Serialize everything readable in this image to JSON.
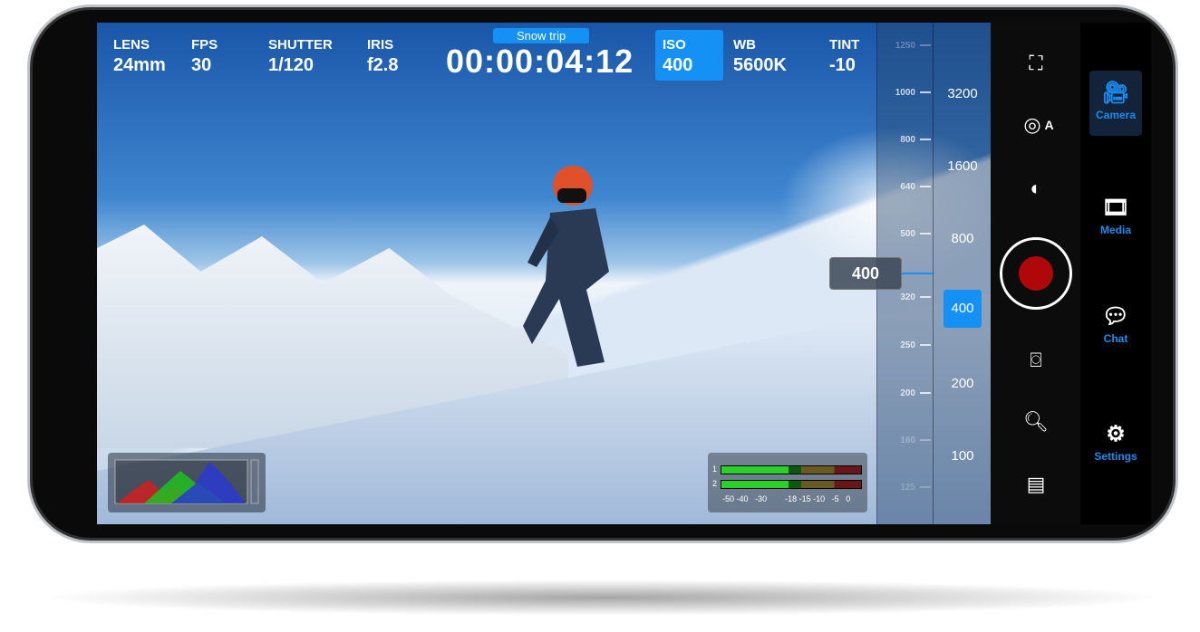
{
  "topbar": {
    "lens": {
      "label": "LENS",
      "value": "24mm"
    },
    "fps": {
      "label": "FPS",
      "value": "30"
    },
    "shutter": {
      "label": "SHUTTER",
      "value": "1/120"
    },
    "iris": {
      "label": "IRIS",
      "value": "f2.8"
    },
    "project": "Snow trip",
    "timecode": "00:00:04:12",
    "iso": {
      "label": "ISO",
      "value": "400"
    },
    "wb": {
      "label": "WB",
      "value": "5600K"
    },
    "tint": {
      "label": "TINT",
      "value": "-10"
    }
  },
  "iso_ruler": {
    "fine_ticks": [
      "1250",
      "1000",
      "800",
      "640",
      "500",
      "320",
      "250",
      "200",
      "160",
      "125"
    ],
    "major": [
      "3200",
      "1600",
      "800",
      "400",
      "200",
      "100"
    ],
    "selected": "400",
    "current_label": "400",
    "accent": "#1591f5"
  },
  "audio_meters": {
    "channels": [
      "1",
      "2"
    ],
    "scale": [
      "-50",
      "-40",
      "-30",
      "-18",
      "-15",
      "-10",
      "-5",
      "0"
    ]
  },
  "controls": [
    {
      "icon": "frame-guides-icon"
    },
    {
      "icon": "auto-focus-icon",
      "label": "A"
    },
    {
      "icon": "exposure-compensation-icon"
    },
    {
      "icon": "record-button"
    },
    {
      "icon": "stabilization-icon"
    },
    {
      "icon": "zoom-in-icon"
    },
    {
      "icon": "slate-icon"
    }
  ],
  "sidebar": [
    {
      "label": "Camera",
      "icon": "camera-icon",
      "active": true
    },
    {
      "label": "Media",
      "icon": "film-icon"
    },
    {
      "label": "Chat",
      "icon": "chat-icon"
    },
    {
      "label": "Settings",
      "icon": "gear-icon"
    }
  ]
}
